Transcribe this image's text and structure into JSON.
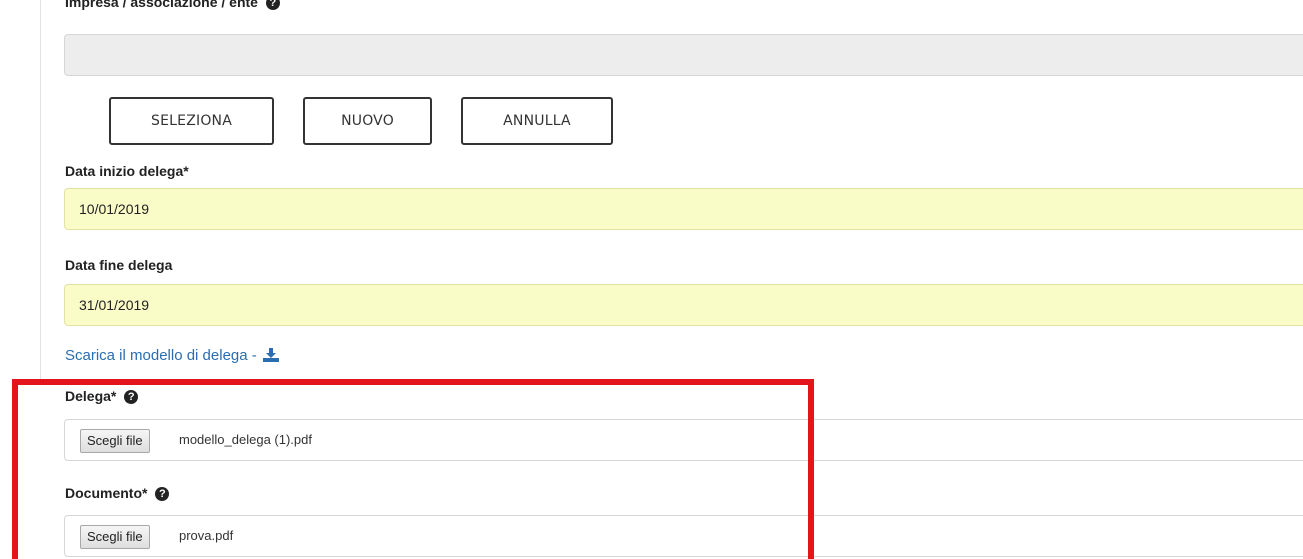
{
  "form": {
    "impresa_label": "Impresa / associazione / ente",
    "impresa_value": "",
    "buttons": {
      "seleziona": "SELEZIONA",
      "nuovo": "NUOVO",
      "annulla": "ANNULLA"
    },
    "data_inizio": {
      "label": "Data inizio delega*",
      "value": "10/01/2019"
    },
    "data_fine": {
      "label": "Data fine delega",
      "value": "31/01/2019"
    },
    "download_link": "Scarica il modello di delega - ",
    "delega": {
      "label": "Delega*",
      "button": "Scegli file",
      "file_name": "modello_delega (1).pdf"
    },
    "documento": {
      "label": "Documento*",
      "button": "Scegli file",
      "file_name": "prova.pdf"
    }
  },
  "icons": {
    "help": "question-circle-icon",
    "download": "download-icon"
  },
  "colors": {
    "date_field_bg": "#fafcc8",
    "link": "#2a6db0",
    "highlight": "#e3141b"
  }
}
